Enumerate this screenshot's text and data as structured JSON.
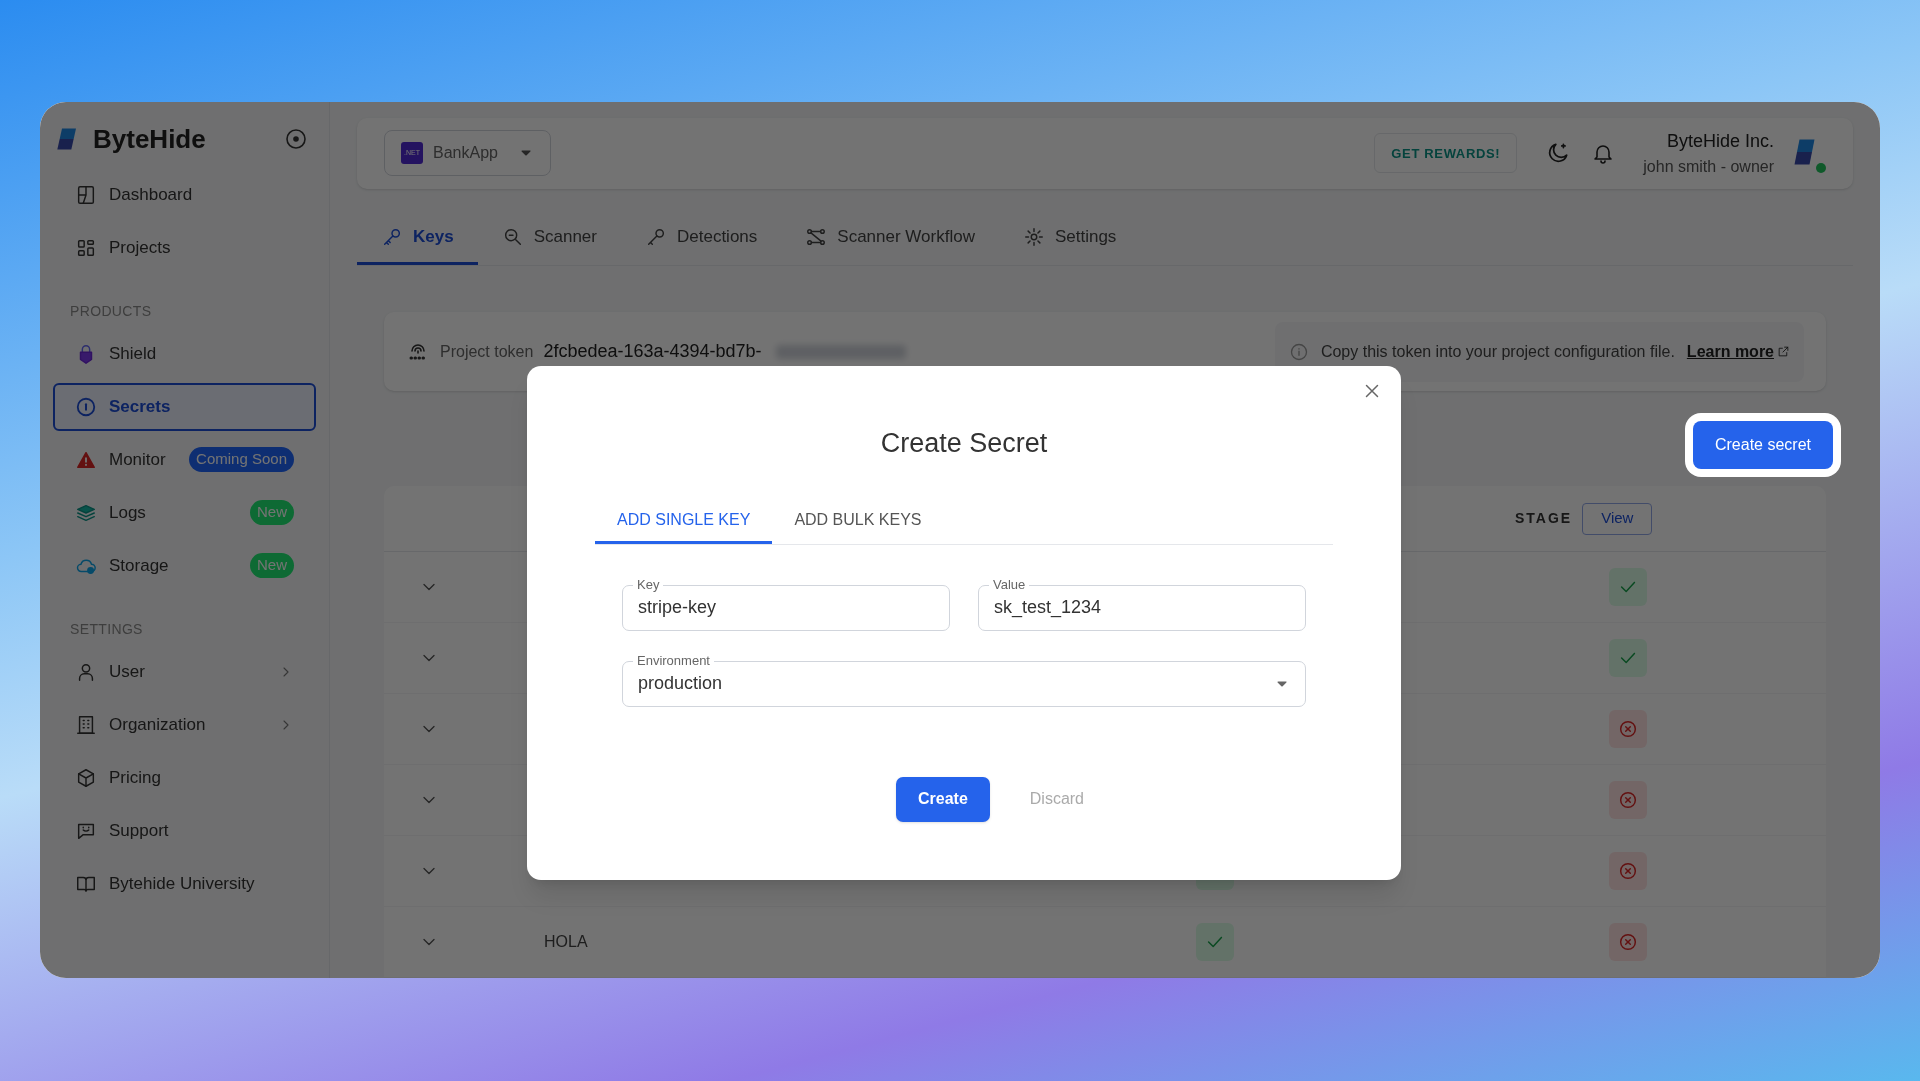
{
  "sidebar": {
    "brand": "ByteHide",
    "items": [
      {
        "kind": "link",
        "label": "Dashboard",
        "selected": false
      },
      {
        "kind": "link",
        "label": "Projects",
        "selected": false
      },
      {
        "kind": "section",
        "label": "PRODUCTS"
      },
      {
        "kind": "link",
        "label": "Shield",
        "selected": false
      },
      {
        "kind": "link",
        "label": "Secrets",
        "selected": true
      },
      {
        "kind": "link",
        "label": "Monitor",
        "selected": false,
        "badge": "Coming Soon",
        "color": "#0e2e72"
      },
      {
        "kind": "link",
        "label": "Logs",
        "selected": false,
        "badge": "New",
        "color": "#0e6a34"
      },
      {
        "kind": "link",
        "label": "Storage",
        "selected": false,
        "badge": "New",
        "color": "#0e6a34"
      },
      {
        "kind": "section",
        "label": "SETTINGS"
      },
      {
        "kind": "submenu",
        "label": "User",
        "selected": false
      },
      {
        "kind": "submenu",
        "label": "Organization",
        "selected": false
      },
      {
        "kind": "link",
        "label": "Pricing",
        "selected": false
      },
      {
        "kind": "link",
        "label": "Support",
        "selected": false
      },
      {
        "kind": "link",
        "label": "Bytehide University",
        "selected": false
      }
    ]
  },
  "topbar": {
    "project_badge": ".NET",
    "project": "BankApp",
    "rewards": "GET REWARDS!",
    "org": "ByteHide Inc.",
    "user": "john smith - owner",
    "online": true
  },
  "tabs": [
    {
      "label": "Keys",
      "selected": true
    },
    {
      "label": "Scanner",
      "selected": false
    },
    {
      "label": "Detections",
      "selected": false
    },
    {
      "label": "Scanner Workflow",
      "selected": false
    },
    {
      "label": "Settings",
      "selected": false
    }
  ],
  "token_card": {
    "label": "Project token",
    "token": "2fcbedea-163a-4394-bd7b-",
    "note": "Copy this token into your project configuration file.",
    "link": "Learn more"
  },
  "create_button": "Create secret",
  "table": {
    "stage_header": "STAGE",
    "view_button": "View",
    "rows": [
      {
        "stage_ok": true
      },
      {
        "stage_ok": true
      },
      {
        "stage_ok": false
      },
      {
        "stage_ok": false
      },
      {
        "verified": true,
        "stage_ok": false
      },
      {
        "name": "HOLA",
        "verified": true,
        "stage_ok": false
      }
    ]
  },
  "modal": {
    "title": "Create Secret",
    "tabs": [
      {
        "label": "ADD SINGLE KEY",
        "selected": true
      },
      {
        "label": "ADD BULK KEYS",
        "selected": false
      }
    ],
    "fields": [
      {
        "kind": "text",
        "label": "Key",
        "value": "stripe-key"
      },
      {
        "kind": "text",
        "label": "Value",
        "value": "sk_test_1234"
      },
      {
        "kind": "select",
        "label": "Environment",
        "value": "production"
      }
    ],
    "primary": "Create",
    "secondary": "Discard"
  }
}
